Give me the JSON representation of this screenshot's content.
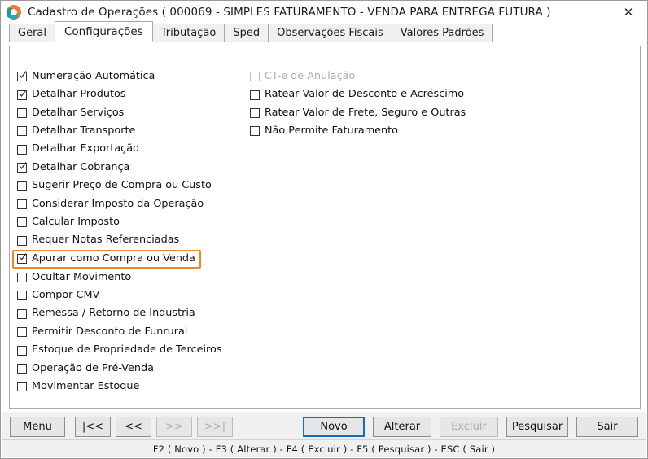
{
  "window": {
    "title": "Cadastro de Operações ( 000069 - SIMPLES FATURAMENTO - VENDA PARA ENTREGA FUTURA )",
    "close_label": "✕",
    "app_icon": "app-logo-icon"
  },
  "tabs": [
    {
      "label": "Geral",
      "active": false
    },
    {
      "label": "Configurações",
      "active": true
    },
    {
      "label": "Tributação",
      "active": false
    },
    {
      "label": "Sped",
      "active": false
    },
    {
      "label": "Observações Fiscais",
      "active": false
    },
    {
      "label": "Valores Padrões",
      "active": false
    }
  ],
  "options": {
    "left_column": [
      {
        "label": "Numeração Automática",
        "checked": true,
        "disabled": false,
        "highlighted": false
      },
      {
        "label": "Detalhar Produtos",
        "checked": true,
        "disabled": false,
        "highlighted": false
      },
      {
        "label": "Detalhar Serviços",
        "checked": false,
        "disabled": false,
        "highlighted": false
      },
      {
        "label": "Detalhar Transporte",
        "checked": false,
        "disabled": false,
        "highlighted": false
      },
      {
        "label": "Detalhar Exportação",
        "checked": false,
        "disabled": false,
        "highlighted": false
      },
      {
        "label": "Detalhar Cobrança",
        "checked": true,
        "disabled": false,
        "highlighted": false
      },
      {
        "label": "Sugerir Preço de Compra ou Custo",
        "checked": false,
        "disabled": false,
        "highlighted": false
      },
      {
        "label": "Considerar Imposto da Operação",
        "checked": false,
        "disabled": false,
        "highlighted": false
      },
      {
        "label": "Calcular Imposto",
        "checked": false,
        "disabled": false,
        "highlighted": false
      },
      {
        "label": "Requer Notas Referenciadas",
        "checked": false,
        "disabled": false,
        "highlighted": false
      },
      {
        "label": "Apurar como Compra ou Venda",
        "checked": true,
        "disabled": false,
        "highlighted": true
      },
      {
        "label": "Ocultar Movimento",
        "checked": false,
        "disabled": false,
        "highlighted": false
      },
      {
        "label": "Compor CMV",
        "checked": false,
        "disabled": false,
        "highlighted": false
      },
      {
        "label": "Remessa / Retorno de Industria",
        "checked": false,
        "disabled": false,
        "highlighted": false
      },
      {
        "label": "Permitir Desconto de Funrural",
        "checked": false,
        "disabled": false,
        "highlighted": false
      },
      {
        "label": "Estoque de Propriedade de Terceiros",
        "checked": false,
        "disabled": false,
        "highlighted": false
      },
      {
        "label": "Operação de Pré-Venda",
        "checked": false,
        "disabled": false,
        "highlighted": false
      },
      {
        "label": "Movimentar Estoque",
        "checked": false,
        "disabled": false,
        "highlighted": false
      }
    ],
    "right_column": [
      {
        "label": "CT-e de Anulação",
        "checked": false,
        "disabled": true,
        "highlighted": false
      },
      {
        "label": "Ratear Valor de Desconto e Acréscimo",
        "checked": false,
        "disabled": false,
        "highlighted": false
      },
      {
        "label": "Ratear Valor de Frete, Seguro e Outras",
        "checked": false,
        "disabled": false,
        "highlighted": false
      },
      {
        "label": "Não Permite Faturamento",
        "checked": false,
        "disabled": false,
        "highlighted": false
      }
    ]
  },
  "toolbar": {
    "menu_label": "Menu",
    "menu_accel": "M",
    "nav_first": "|<<",
    "nav_prev": "<<",
    "nav_next": ">>",
    "nav_last": ">>|",
    "novo_label": "Novo",
    "novo_accel": "N",
    "alterar_label": "Alterar",
    "alterar_accel": "A",
    "excluir_label": "Excluir",
    "excluir_accel": "E",
    "pesquisar_label": "Pesquisar",
    "sair_label": "Sair"
  },
  "statusbar": {
    "text": "F2 ( Novo )  -  F3 ( Alterar )  -  F4 ( Excluir )  -  F5 ( Pesquisar )  -  ESC ( Sair )"
  },
  "colors": {
    "highlight_orange": "#ef8627",
    "focus_blue": "#0f6fc5",
    "panel_bg": "#ffffff",
    "chrome_gray": "#f0f0f0"
  }
}
